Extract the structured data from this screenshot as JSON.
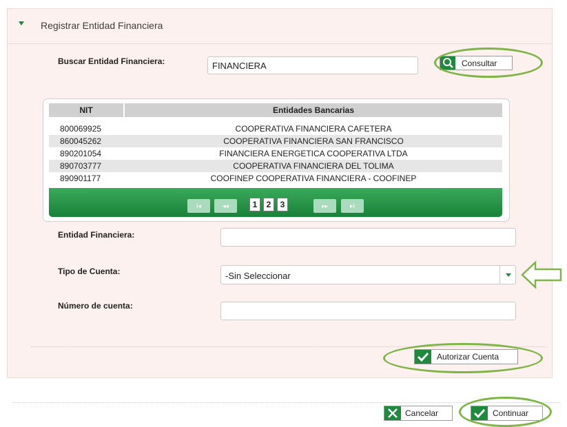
{
  "header": {
    "title": "Registrar Entidad Financiera"
  },
  "search": {
    "label": "Buscar Entidad Financiera:",
    "value": "FINANCIERA",
    "button_label": "Consultar"
  },
  "grid": {
    "columns": [
      "NIT",
      "Entidades Bancarias"
    ],
    "rows": [
      {
        "nit": "800069925",
        "entidad": "COOPERATIVA FINANCIERA CAFETERA"
      },
      {
        "nit": "860045262",
        "entidad": "COOPERATIVA FINANCIERA SAN FRANCISCO"
      },
      {
        "nit": "890201054",
        "entidad": "FINANCIERA ENERGETICA COOPERATIVA LTDA"
      },
      {
        "nit": "890703777",
        "entidad": "COOPERATIVA FINANCIERA DEL TOLIMA"
      },
      {
        "nit": "890901177",
        "entidad": "COOFINEP COOPERATIVA FINANCIERA - COOFINEP"
      }
    ],
    "pager": {
      "first": "I◂",
      "prev": "◂◂",
      "pages": [
        "1",
        "2",
        "3"
      ],
      "next": "▸▸",
      "last": "▸I"
    }
  },
  "form": {
    "entidad_label": "Entidad Financiera:",
    "entidad_value": "",
    "tipo_label": "Tipo de Cuenta:",
    "tipo_value": "-Sin Seleccionar",
    "numero_label": "Número de cuenta:",
    "numero_value": ""
  },
  "buttons": {
    "autorizar": "Autorizar Cuenta",
    "cancelar": "Cancelar",
    "continuar": "Continuar"
  },
  "colors": {
    "accent": "#1e8a3c",
    "panel_bg": "#fcf1ee",
    "highlight": "#7fb447"
  },
  "icons": {
    "consultar": "search-icon",
    "autorizar": "check-icon",
    "cancelar": "close-icon",
    "continuar": "check-icon",
    "tipo_dropdown": "chevron-down-icon",
    "annotation": "arrow-left-icon"
  }
}
